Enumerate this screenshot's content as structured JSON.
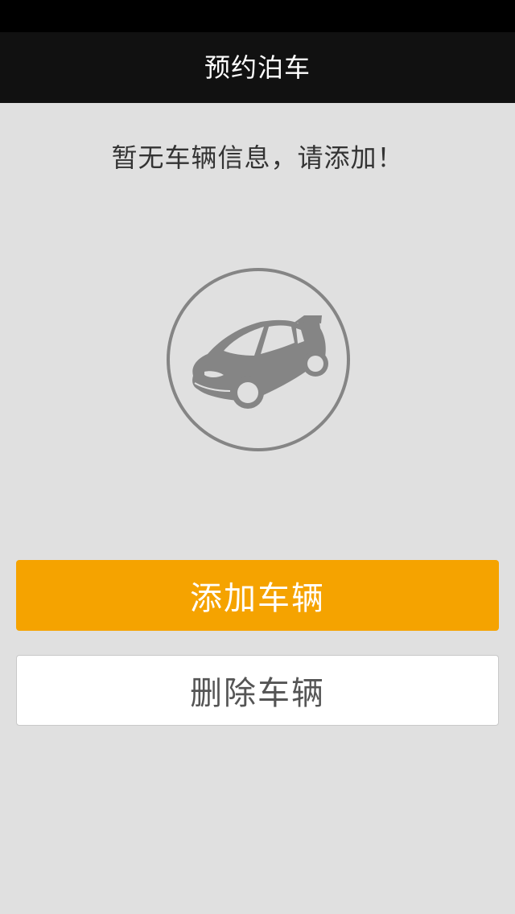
{
  "header": {
    "title": "预约泊车"
  },
  "main": {
    "empty_message": "暂无车辆信息，请添加！",
    "illustration_icon": "car-icon",
    "add_button_label": "添加车辆",
    "delete_button_label": "删除车辆"
  },
  "colors": {
    "accent": "#f5a300",
    "nav_background": "#111111",
    "page_background": "#e0e0e0",
    "icon_gray": "#858585"
  }
}
